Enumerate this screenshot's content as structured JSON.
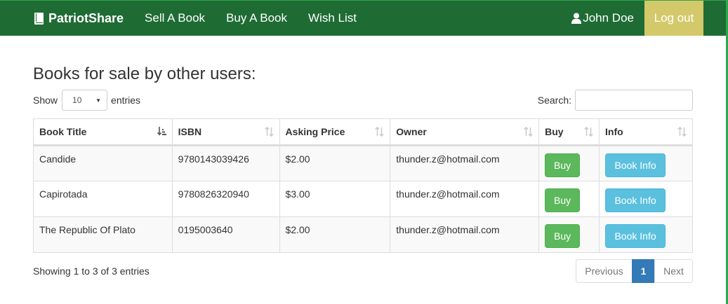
{
  "nav": {
    "brand": "PatriotShare",
    "links": [
      "Sell A Book",
      "Buy A Book",
      "Wish List"
    ],
    "user": "John Doe",
    "logout": "Log out",
    "colors": {
      "navbar": "#1e6b34",
      "logout": "#d4c96a"
    }
  },
  "page": {
    "heading": "Books for sale by other users:",
    "length": {
      "show_label": "Show",
      "selected": "10",
      "entries_label": "entries"
    },
    "search": {
      "label": "Search:",
      "value": "",
      "placeholder": ""
    }
  },
  "table": {
    "columns": [
      "Book Title",
      "ISBN",
      "Asking Price",
      "Owner",
      "Buy",
      "Info"
    ],
    "sorted_column": "Book Title",
    "rows": [
      {
        "title": "Candide",
        "isbn": "9780143039426",
        "price": "$2.00",
        "owner": "thunder.z@hotmail.com",
        "buy": "Buy",
        "info": "Book Info"
      },
      {
        "title": "Capirotada",
        "isbn": "9780826320940",
        "price": "$3.00",
        "owner": "thunder.z@hotmail.com",
        "buy": "Buy",
        "info": "Book Info"
      },
      {
        "title": "The Republic Of Plato",
        "isbn": "0195003640",
        "price": "$2.00",
        "owner": "thunder.z@hotmail.com",
        "buy": "Buy",
        "info": "Book Info"
      }
    ]
  },
  "footer": {
    "info": "Showing 1 to 3 of 3 entries",
    "previous": "Previous",
    "current_page": "1",
    "next": "Next"
  }
}
